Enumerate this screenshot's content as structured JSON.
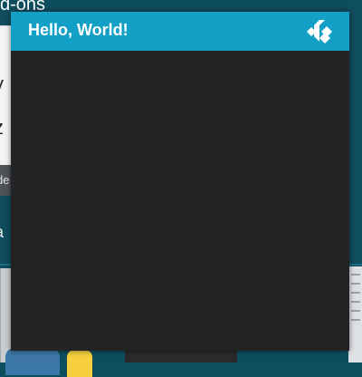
{
  "background": {
    "section_title": "d-ons",
    "glyph_1": "y",
    "glyph_2": "z",
    "button_label": "de",
    "item_text": "a"
  },
  "dialog": {
    "title": "Hello, World!",
    "logo_icon": "kodi-logo-icon"
  },
  "colors": {
    "header": "#12a0c6",
    "dialog_body": "#232323",
    "background": "#0f4e5f"
  }
}
